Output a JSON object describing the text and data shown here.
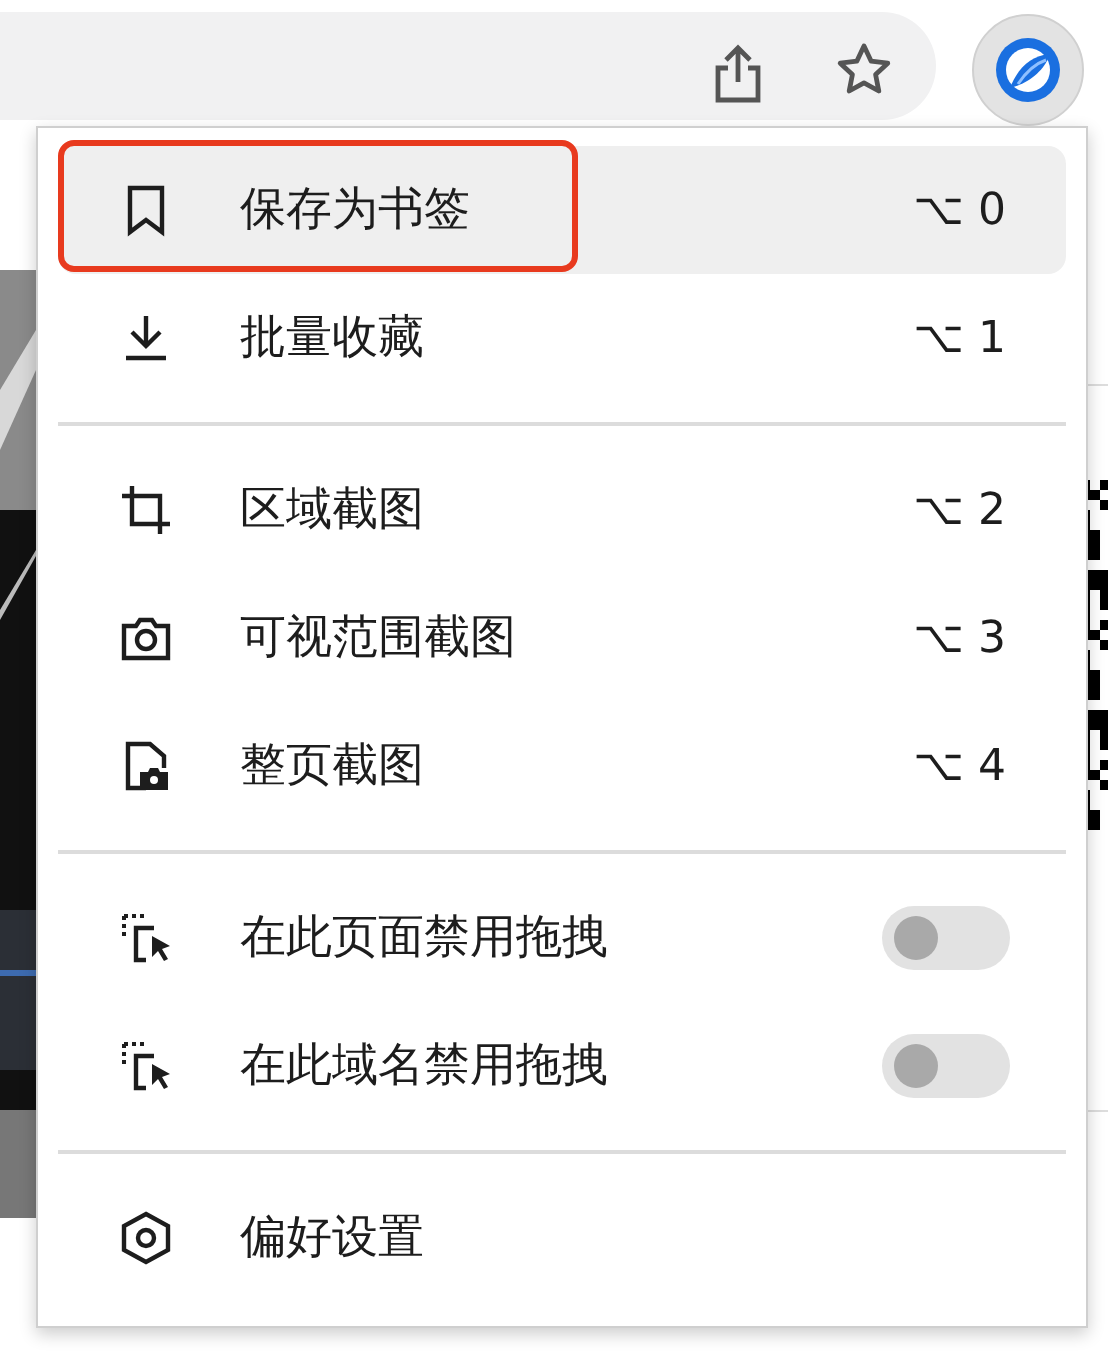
{
  "menu": {
    "sections": [
      {
        "items": [
          {
            "label": "保存为书签",
            "kind": "shortcut",
            "shortcut": "⌥ 0",
            "selected": true,
            "outlined": true
          },
          {
            "label": "批量收藏",
            "kind": "shortcut",
            "shortcut": "⌥ 1",
            "selected": false,
            "outlined": false
          }
        ]
      },
      {
        "items": [
          {
            "label": "区域截图",
            "kind": "shortcut",
            "shortcut": "⌥ 2",
            "selected": false,
            "outlined": false
          },
          {
            "label": "可视范围截图",
            "kind": "shortcut",
            "shortcut": "⌥ 3",
            "selected": false,
            "outlined": false
          },
          {
            "label": "整页截图",
            "kind": "shortcut",
            "shortcut": "⌥ 4",
            "selected": false,
            "outlined": false
          }
        ]
      },
      {
        "items": [
          {
            "label": "在此页面禁用拖拽",
            "kind": "toggle",
            "on": false,
            "selected": false,
            "outlined": false
          },
          {
            "label": "在此域名禁用拖拽",
            "kind": "toggle",
            "on": false,
            "selected": false,
            "outlined": false
          }
        ]
      },
      {
        "items": [
          {
            "label": "偏好设置",
            "kind": "plain",
            "selected": false,
            "outlined": false
          }
        ]
      }
    ]
  }
}
